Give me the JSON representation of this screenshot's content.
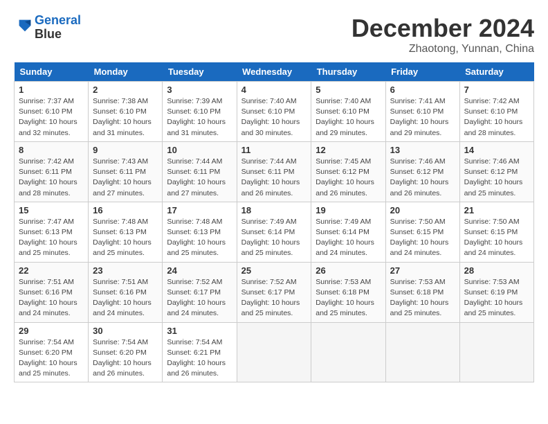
{
  "logo": {
    "line1": "General",
    "line2": "Blue"
  },
  "title": "December 2024",
  "subtitle": "Zhaotong, Yunnan, China",
  "weekdays": [
    "Sunday",
    "Monday",
    "Tuesday",
    "Wednesday",
    "Thursday",
    "Friday",
    "Saturday"
  ],
  "weeks": [
    [
      {
        "day": "1",
        "sunrise": "Sunrise: 7:37 AM",
        "sunset": "Sunset: 6:10 PM",
        "daylight": "Daylight: 10 hours and 32 minutes."
      },
      {
        "day": "2",
        "sunrise": "Sunrise: 7:38 AM",
        "sunset": "Sunset: 6:10 PM",
        "daylight": "Daylight: 10 hours and 31 minutes."
      },
      {
        "day": "3",
        "sunrise": "Sunrise: 7:39 AM",
        "sunset": "Sunset: 6:10 PM",
        "daylight": "Daylight: 10 hours and 31 minutes."
      },
      {
        "day": "4",
        "sunrise": "Sunrise: 7:40 AM",
        "sunset": "Sunset: 6:10 PM",
        "daylight": "Daylight: 10 hours and 30 minutes."
      },
      {
        "day": "5",
        "sunrise": "Sunrise: 7:40 AM",
        "sunset": "Sunset: 6:10 PM",
        "daylight": "Daylight: 10 hours and 29 minutes."
      },
      {
        "day": "6",
        "sunrise": "Sunrise: 7:41 AM",
        "sunset": "Sunset: 6:10 PM",
        "daylight": "Daylight: 10 hours and 29 minutes."
      },
      {
        "day": "7",
        "sunrise": "Sunrise: 7:42 AM",
        "sunset": "Sunset: 6:10 PM",
        "daylight": "Daylight: 10 hours and 28 minutes."
      }
    ],
    [
      {
        "day": "8",
        "sunrise": "Sunrise: 7:42 AM",
        "sunset": "Sunset: 6:11 PM",
        "daylight": "Daylight: 10 hours and 28 minutes."
      },
      {
        "day": "9",
        "sunrise": "Sunrise: 7:43 AM",
        "sunset": "Sunset: 6:11 PM",
        "daylight": "Daylight: 10 hours and 27 minutes."
      },
      {
        "day": "10",
        "sunrise": "Sunrise: 7:44 AM",
        "sunset": "Sunset: 6:11 PM",
        "daylight": "Daylight: 10 hours and 27 minutes."
      },
      {
        "day": "11",
        "sunrise": "Sunrise: 7:44 AM",
        "sunset": "Sunset: 6:11 PM",
        "daylight": "Daylight: 10 hours and 26 minutes."
      },
      {
        "day": "12",
        "sunrise": "Sunrise: 7:45 AM",
        "sunset": "Sunset: 6:12 PM",
        "daylight": "Daylight: 10 hours and 26 minutes."
      },
      {
        "day": "13",
        "sunrise": "Sunrise: 7:46 AM",
        "sunset": "Sunset: 6:12 PM",
        "daylight": "Daylight: 10 hours and 26 minutes."
      },
      {
        "day": "14",
        "sunrise": "Sunrise: 7:46 AM",
        "sunset": "Sunset: 6:12 PM",
        "daylight": "Daylight: 10 hours and 25 minutes."
      }
    ],
    [
      {
        "day": "15",
        "sunrise": "Sunrise: 7:47 AM",
        "sunset": "Sunset: 6:13 PM",
        "daylight": "Daylight: 10 hours and 25 minutes."
      },
      {
        "day": "16",
        "sunrise": "Sunrise: 7:48 AM",
        "sunset": "Sunset: 6:13 PM",
        "daylight": "Daylight: 10 hours and 25 minutes."
      },
      {
        "day": "17",
        "sunrise": "Sunrise: 7:48 AM",
        "sunset": "Sunset: 6:13 PM",
        "daylight": "Daylight: 10 hours and 25 minutes."
      },
      {
        "day": "18",
        "sunrise": "Sunrise: 7:49 AM",
        "sunset": "Sunset: 6:14 PM",
        "daylight": "Daylight: 10 hours and 25 minutes."
      },
      {
        "day": "19",
        "sunrise": "Sunrise: 7:49 AM",
        "sunset": "Sunset: 6:14 PM",
        "daylight": "Daylight: 10 hours and 24 minutes."
      },
      {
        "day": "20",
        "sunrise": "Sunrise: 7:50 AM",
        "sunset": "Sunset: 6:15 PM",
        "daylight": "Daylight: 10 hours and 24 minutes."
      },
      {
        "day": "21",
        "sunrise": "Sunrise: 7:50 AM",
        "sunset": "Sunset: 6:15 PM",
        "daylight": "Daylight: 10 hours and 24 minutes."
      }
    ],
    [
      {
        "day": "22",
        "sunrise": "Sunrise: 7:51 AM",
        "sunset": "Sunset: 6:16 PM",
        "daylight": "Daylight: 10 hours and 24 minutes."
      },
      {
        "day": "23",
        "sunrise": "Sunrise: 7:51 AM",
        "sunset": "Sunset: 6:16 PM",
        "daylight": "Daylight: 10 hours and 24 minutes."
      },
      {
        "day": "24",
        "sunrise": "Sunrise: 7:52 AM",
        "sunset": "Sunset: 6:17 PM",
        "daylight": "Daylight: 10 hours and 24 minutes."
      },
      {
        "day": "25",
        "sunrise": "Sunrise: 7:52 AM",
        "sunset": "Sunset: 6:17 PM",
        "daylight": "Daylight: 10 hours and 25 minutes."
      },
      {
        "day": "26",
        "sunrise": "Sunrise: 7:53 AM",
        "sunset": "Sunset: 6:18 PM",
        "daylight": "Daylight: 10 hours and 25 minutes."
      },
      {
        "day": "27",
        "sunrise": "Sunrise: 7:53 AM",
        "sunset": "Sunset: 6:18 PM",
        "daylight": "Daylight: 10 hours and 25 minutes."
      },
      {
        "day": "28",
        "sunrise": "Sunrise: 7:53 AM",
        "sunset": "Sunset: 6:19 PM",
        "daylight": "Daylight: 10 hours and 25 minutes."
      }
    ],
    [
      {
        "day": "29",
        "sunrise": "Sunrise: 7:54 AM",
        "sunset": "Sunset: 6:20 PM",
        "daylight": "Daylight: 10 hours and 25 minutes."
      },
      {
        "day": "30",
        "sunrise": "Sunrise: 7:54 AM",
        "sunset": "Sunset: 6:20 PM",
        "daylight": "Daylight: 10 hours and 26 minutes."
      },
      {
        "day": "31",
        "sunrise": "Sunrise: 7:54 AM",
        "sunset": "Sunset: 6:21 PM",
        "daylight": "Daylight: 10 hours and 26 minutes."
      },
      null,
      null,
      null,
      null
    ]
  ]
}
